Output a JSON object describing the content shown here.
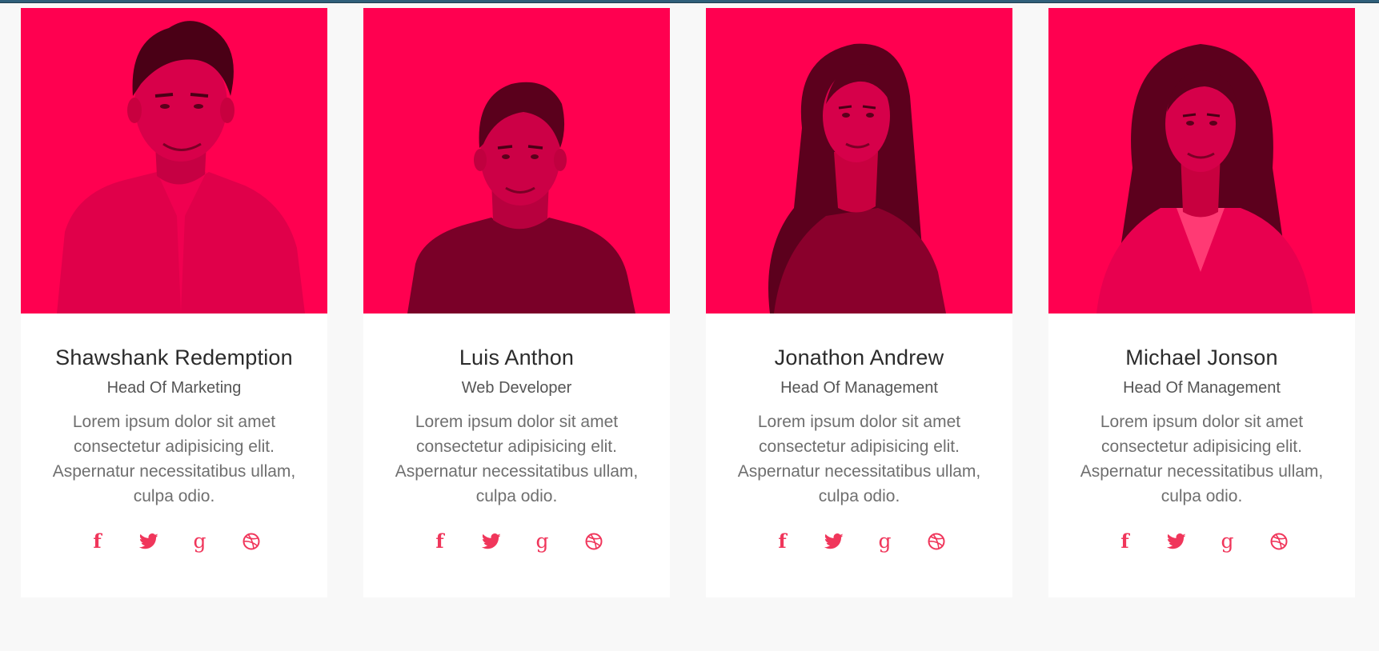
{
  "colors": {
    "accent": "#f0365b",
    "photo_overlay": "#ff0050",
    "page_background": "#f8f8f8",
    "card_background": "#ffffff"
  },
  "team": [
    {
      "name": "Shawshank Redemption",
      "role": "Head Of Marketing",
      "bio": "Lorem ipsum dolor sit amet consectetur adipisicing elit. Aspernatur necessitatibus ullam, culpa odio.",
      "photo": "man-in-checked-shirt-portrait",
      "socials": [
        "facebook-icon",
        "twitter-icon",
        "google-plus-icon",
        "dribbble-icon"
      ]
    },
    {
      "name": "Luis Anthon",
      "role": "Web Developer",
      "bio": "Lorem ipsum dolor sit amet consectetur adipisicing elit. Aspernatur necessitatibus ullam, culpa odio.",
      "photo": "young-man-in-t-shirt-portrait",
      "socials": [
        "facebook-icon",
        "twitter-icon",
        "google-plus-icon",
        "dribbble-icon"
      ]
    },
    {
      "name": "Jonathon Andrew",
      "role": "Head Of Management",
      "bio": "Lorem ipsum dolor sit amet consectetur adipisicing elit. Aspernatur necessitatibus ullam, culpa odio.",
      "photo": "woman-with-long-dark-hair-portrait",
      "socials": [
        "facebook-icon",
        "twitter-icon",
        "google-plus-icon",
        "dribbble-icon"
      ]
    },
    {
      "name": "Michael Jonson",
      "role": "Head Of Management",
      "bio": "Lorem ipsum dolor sit amet consectetur adipisicing elit. Aspernatur necessitatibus ullam, culpa odio.",
      "photo": "smiling-woman-in-blazer-portrait",
      "socials": [
        "facebook-icon",
        "twitter-icon",
        "google-plus-icon",
        "dribbble-icon"
      ]
    }
  ],
  "social_glyphs": {
    "facebook": "f",
    "google_plus": "g"
  }
}
